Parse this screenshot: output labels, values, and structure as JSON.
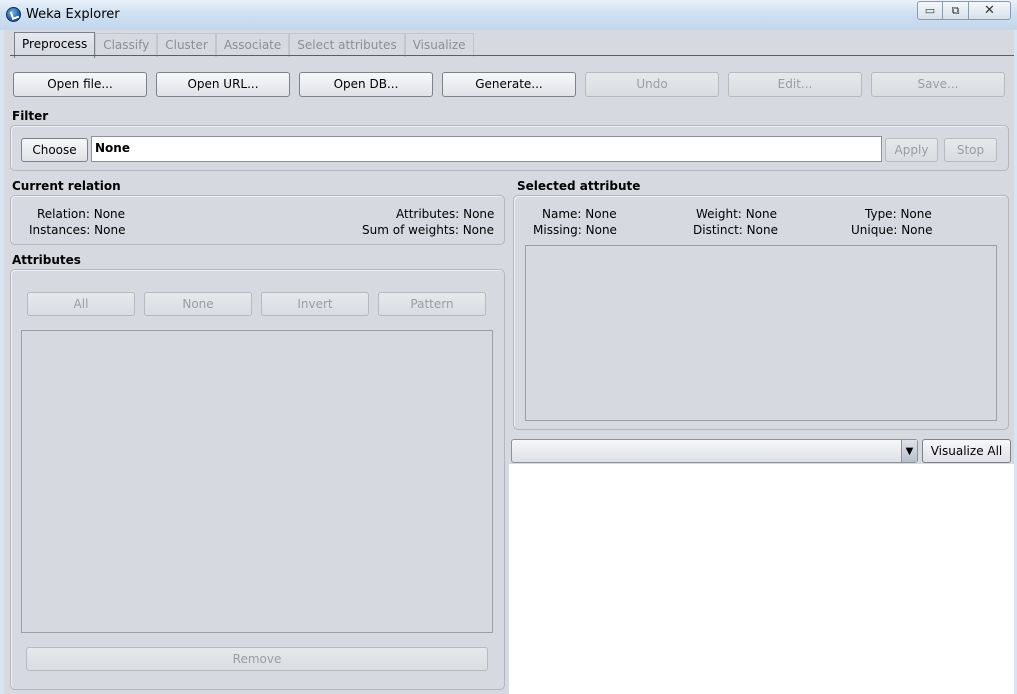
{
  "window": {
    "title": "Weka Explorer",
    "min_glyph": "▭",
    "max_glyph": "⧉",
    "close_glyph": "✕"
  },
  "tabs": [
    {
      "label": "Preprocess",
      "active": true
    },
    {
      "label": "Classify",
      "active": false
    },
    {
      "label": "Cluster",
      "active": false
    },
    {
      "label": "Associate",
      "active": false
    },
    {
      "label": "Select attributes",
      "active": false
    },
    {
      "label": "Visualize",
      "active": false
    }
  ],
  "toolbar": {
    "open_file": "Open file...",
    "open_url": "Open URL...",
    "open_db": "Open DB...",
    "generate": "Generate...",
    "undo": "Undo",
    "edit": "Edit...",
    "save": "Save..."
  },
  "filter": {
    "section": "Filter",
    "choose": "Choose",
    "value": "None",
    "apply": "Apply",
    "stop": "Stop"
  },
  "current_relation": {
    "section": "Current relation",
    "relation_label": "Relation:",
    "relation_value": "None",
    "instances_label": "Instances:",
    "instances_value": "None",
    "attributes_label": "Attributes:",
    "attributes_value": "None",
    "sum_weights_label": "Sum of weights:",
    "sum_weights_value": "None"
  },
  "attributes": {
    "section": "Attributes",
    "all": "All",
    "none": "None",
    "invert": "Invert",
    "pattern": "Pattern",
    "remove": "Remove"
  },
  "selected_attribute": {
    "section": "Selected attribute",
    "name_label": "Name:",
    "name_value": "None",
    "weight_label": "Weight:",
    "weight_value": "None",
    "type_label": "Type:",
    "type_value": "None",
    "missing_label": "Missing:",
    "missing_value": "None",
    "distinct_label": "Distinct:",
    "distinct_value": "None",
    "unique_label": "Unique:",
    "unique_value": "None"
  },
  "visualize": {
    "combo_value": "",
    "arrow_glyph": "▼",
    "visualize_all": "Visualize All"
  }
}
